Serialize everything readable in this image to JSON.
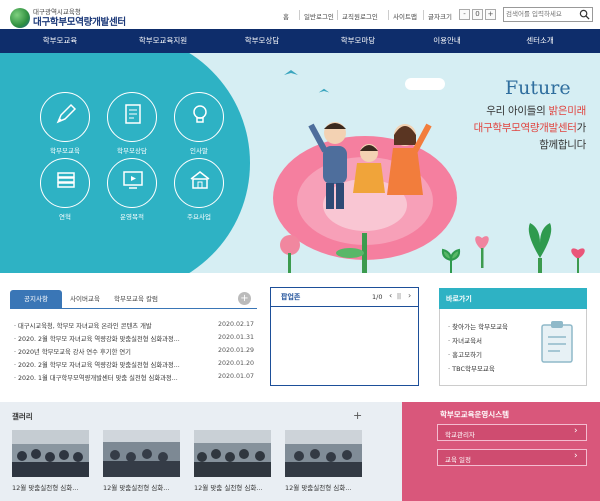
{
  "header": {
    "org": "대구광역시교육청",
    "title": "대구학부모역량개발센터"
  },
  "util": {
    "home": "홈",
    "login": "일반로그인",
    "teacher_login": "교직원로그인",
    "sitemap": "사이트맵",
    "zoom": "글자크기",
    "zoom_minus": "-",
    "zoom_reset": "0",
    "zoom_plus": "+"
  },
  "search": {
    "placeholder": "검색어를 입력하세요"
  },
  "nav": [
    "학부모교육",
    "학부모교육지원",
    "학부모상담",
    "학부모마당",
    "이용안내",
    "센터소개"
  ],
  "hero": {
    "circles": [
      "학부모교육",
      "학부모상담",
      "인사말",
      "연혁",
      "운영목적",
      "주요사업"
    ],
    "future": "Future",
    "line1a": "우리 아이들의 ",
    "line1b": "밝은미래",
    "line2a": "대구학부모역량개발센터",
    "line2b": "가",
    "line3": "함께합니다"
  },
  "notice": {
    "tabs": [
      "공지사항",
      "사이버교육",
      "학부모교육 칼럼"
    ],
    "more": "+",
    "rows": [
      {
        "title": "대구시교육청, 학부모 자녀교육 온라인 콘텐츠 개발",
        "date": "2020.02.17"
      },
      {
        "title": "2020. 2월 학부모 자녀교육 역량강화 맞춤실천형 심화과정...",
        "date": "2020.01.31"
      },
      {
        "title": "2020년 학부모교육 강사 연수 후기한 연기",
        "date": "2020.01.29"
      },
      {
        "title": "2020. 2월 학부모 자녀교육 역량강화 맞춤실천형 심화과정...",
        "date": "2020.01.20"
      },
      {
        "title": "2020. 1월 대구학부모역량개발센터 맞춤 실천형 심화과정...",
        "date": "2020.01.07"
      }
    ]
  },
  "popup": {
    "title": "팝업존",
    "counter": "1/0",
    "prev": "‹",
    "pause": "||",
    "next": "›"
  },
  "quick": {
    "title": "바로가기",
    "items": [
      "찾아가는 학부모교육",
      "자녀교육서",
      "홍고모하기",
      "TBC학부모교육"
    ]
  },
  "gallery": {
    "title": "갤러리",
    "more": "+",
    "captions": [
      "12월 맞춤실천형 심화...",
      "12월 맞춤실천형 심화...",
      "12월 맞춤 실천형 심화...",
      "12월 맞춤실천형 심화..."
    ]
  },
  "system": {
    "title": "학부모교육운영시스템",
    "buttons": [
      "학교관리자",
      "교육 일정"
    ],
    "arrow": "›"
  }
}
